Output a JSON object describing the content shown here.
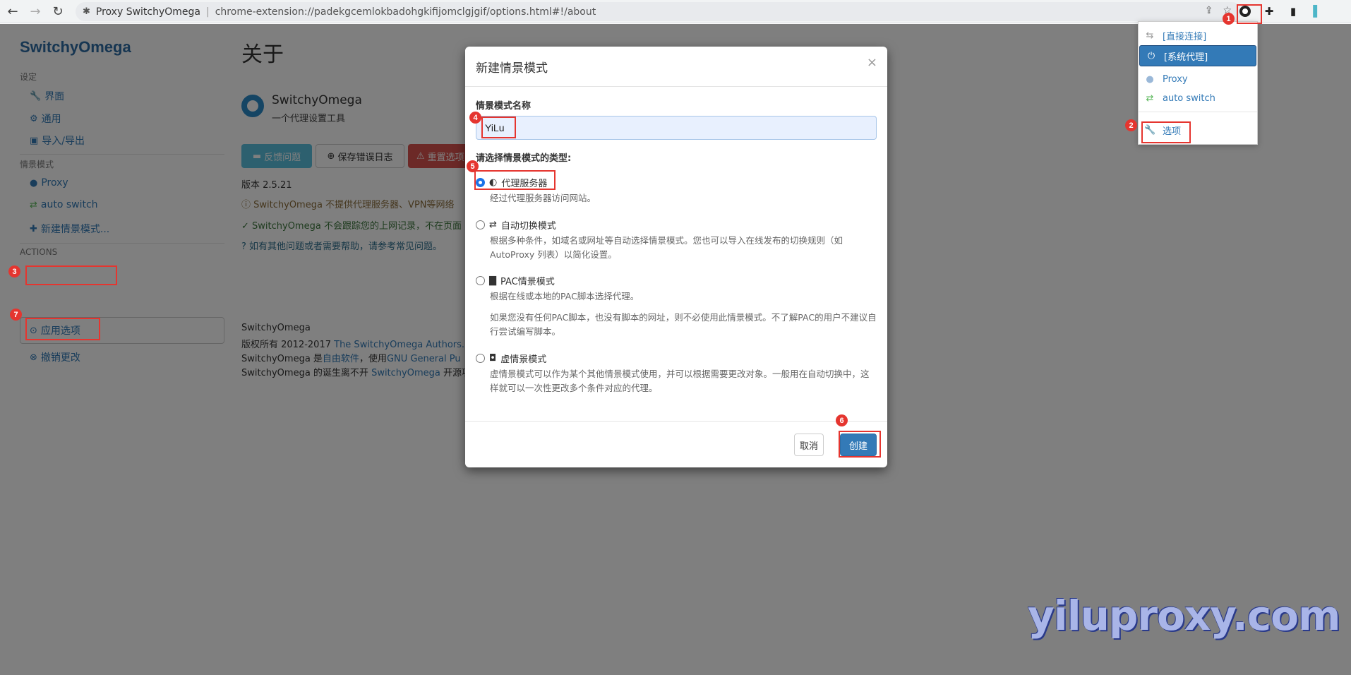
{
  "browser": {
    "tab_title": "Proxy SwitchyOmega",
    "url": "chrome-extension://padekgcemlokbadohgkifijomclgjgif/options.html#!/about"
  },
  "sidebar": {
    "brand": "SwitchyOmega",
    "settings_heading": "设定",
    "settings_items": [
      "界面",
      "通用",
      "导入/导出"
    ],
    "profiles_heading": "情景模式",
    "profile_items": [
      "Proxy",
      "auto switch"
    ],
    "new_profile": "新建情景模式...",
    "actions_heading": "ACTIONS",
    "apply": "应用选项",
    "discard": "撤销更改"
  },
  "main": {
    "title": "关于",
    "app_name": "SwitchyOmega",
    "app_tagline": "一个代理设置工具",
    "buttons": {
      "feedback": "反馈问题",
      "save_log": "保存错误日志",
      "reset": "重置选项"
    },
    "version": "版本 2.5.21",
    "notice_1": "SwitchyOmega 不提供代理服务器、VPN等网络",
    "notice_2": "SwitchyOmega 不会跟踪您的上网记录，不在页面",
    "notice_3": "如有其他问题或者需要帮助，请参考常见问题。",
    "footer_1": "SwitchyOmega",
    "footer_2_pre": "版权所有 2012-2017 ",
    "footer_2_link": "The SwitchyOmega Authors.",
    "footer_3_pre": "SwitchyOmega 是",
    "footer_3_link1": "自由软件",
    "footer_3_mid": "，使用",
    "footer_3_link2": "GNU General Pu",
    "footer_4_pre": "SwitchyOmega 的诞生离不开 ",
    "footer_4_link": "SwitchyOmega",
    "footer_4_post": " 开源项"
  },
  "popup": {
    "items": [
      "[直接连接]",
      "[系统代理]",
      "Proxy",
      "auto switch",
      "选项"
    ]
  },
  "modal": {
    "title": "新建情景模式",
    "close": "×",
    "name_label": "情景模式名称",
    "name_value": "YiLu",
    "type_label": "请选择情景模式的类型:",
    "options": [
      {
        "label": "代理服务器",
        "desc": "经过代理服务器访问网站。"
      },
      {
        "label": "自动切换模式",
        "desc": "根据多种条件，如域名或网址等自动选择情景模式。您也可以导入在线发布的切换规则（如 AutoProxy 列表）以简化设置。"
      },
      {
        "label": "PAC情景模式",
        "desc": "根据在线或本地的PAC脚本选择代理。",
        "desc2": "如果您没有任何PAC脚本，也没有脚本的网址，则不必使用此情景模式。不了解PAC的用户不建议自行尝试编写脚本。"
      },
      {
        "label": "虚情景模式",
        "desc": "虚情景模式可以作为某个其他情景模式使用，并可以根据需要更改对象。一般用在自动切换中，这样就可以一次性更改多个条件对应的代理。"
      }
    ],
    "cancel": "取消",
    "create": "创建"
  },
  "annotations": [
    "1",
    "2",
    "3",
    "4",
    "5",
    "6",
    "7"
  ],
  "watermark": "yiluproxy.com",
  "colors": {
    "accent": "#337ab7",
    "highlight": "#e5352f",
    "brand": "#2e6da4"
  }
}
